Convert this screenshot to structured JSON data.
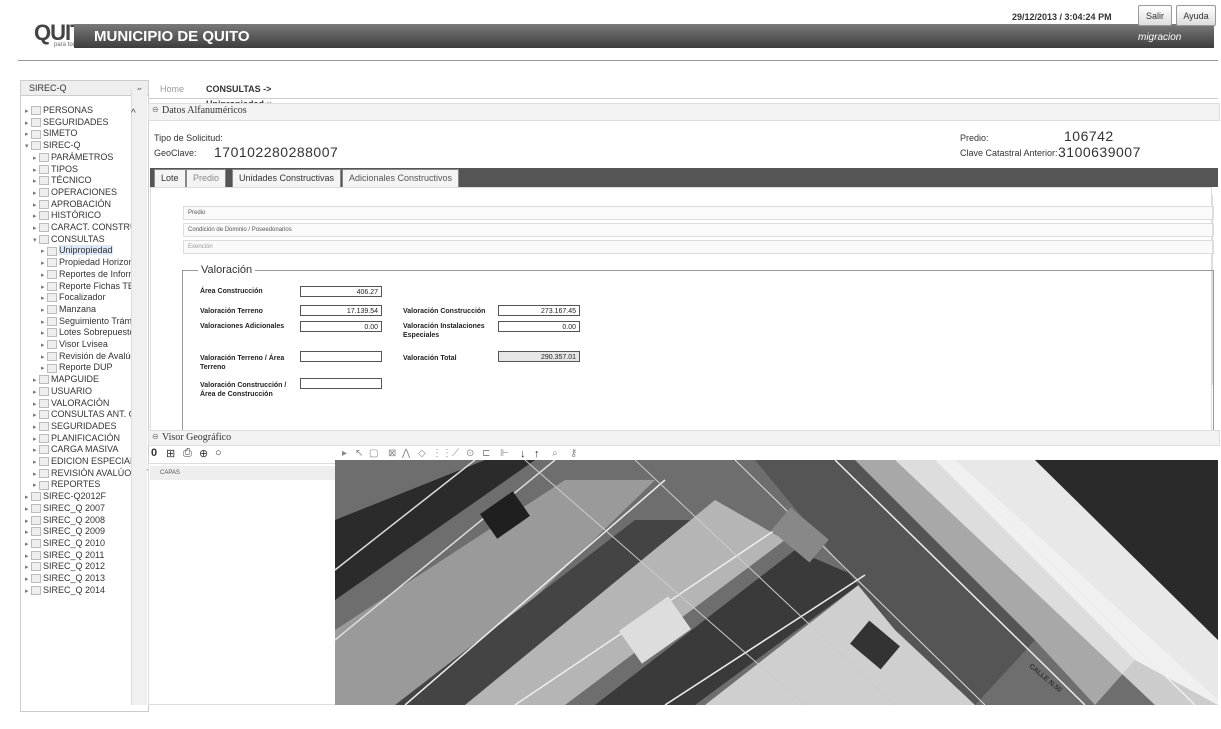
{
  "header": {
    "logo_text": "QUITO",
    "logo_sub": "para todos",
    "brand_title": "MUNICIPIO DE QUITO",
    "datetime": "29/12/2013 / 3:04:24 PM",
    "logout_label": "Salir",
    "help_label": "Ayuda",
    "username": "migracion",
    "brand_color": "#4a4a4a"
  },
  "sidebar": {
    "title": "SIREC-Q",
    "collapse_glyph": "«",
    "items": [
      {
        "label": "PERSONAS",
        "level": 0
      },
      {
        "label": "SEGURIDADES",
        "level": 0
      },
      {
        "label": "SIMETO",
        "level": 0
      },
      {
        "label": "SIREC-Q",
        "level": 0,
        "expanded": true
      },
      {
        "label": "PARÁMETROS",
        "level": 1
      },
      {
        "label": "TIPOS",
        "level": 1
      },
      {
        "label": "TÉCNICO",
        "level": 1
      },
      {
        "label": "OPERACIONES",
        "level": 1
      },
      {
        "label": "APROBACIÓN",
        "level": 1
      },
      {
        "label": "HISTÓRICO",
        "level": 1
      },
      {
        "label": "CARACT. CONSTRUC",
        "level": 1
      },
      {
        "label": "CONSULTAS",
        "level": 1,
        "expanded": true
      },
      {
        "label": "Unipropiedad",
        "level": 2,
        "selected": true
      },
      {
        "label": "Propiedad Horizontal",
        "level": 2
      },
      {
        "label": "Reportes de Informac",
        "level": 2
      },
      {
        "label": "Reporte Fichas TECS",
        "level": 2
      },
      {
        "label": "Focalizador",
        "level": 2
      },
      {
        "label": "Manzana",
        "level": 2
      },
      {
        "label": "Seguimiento Trámites",
        "level": 2
      },
      {
        "label": "Lotes Sobrepuestos",
        "level": 2
      },
      {
        "label": "Visor Lvisea",
        "level": 2
      },
      {
        "label": "Revisión de Avalúo",
        "level": 2
      },
      {
        "label": "Reporte DUP",
        "level": 2
      },
      {
        "label": "MAPGUIDE",
        "level": 1
      },
      {
        "label": "USUARIO",
        "level": 1
      },
      {
        "label": "VALORACIÓN",
        "level": 1
      },
      {
        "label": "CONSULTAS ANT. CAN",
        "level": 1
      },
      {
        "label": "SEGURIDADES",
        "level": 1
      },
      {
        "label": "PLANIFICACIÓN",
        "level": 1
      },
      {
        "label": "CARGA MASIVA",
        "level": 1
      },
      {
        "label": "EDICION ESPECIAL",
        "level": 1
      },
      {
        "label": "REVISIÓN AVALÚO INT",
        "level": 1
      },
      {
        "label": "REPORTES",
        "level": 1
      },
      {
        "label": "SIREC-Q2012F",
        "level": 0
      },
      {
        "label": "SIREC_Q 2007",
        "level": 0
      },
      {
        "label": "SIREC_Q 2008",
        "level": 0
      },
      {
        "label": "SIREC_Q 2009",
        "level": 0
      },
      {
        "label": "SIREC_Q 2010",
        "level": 0
      },
      {
        "label": "SIREC_Q 2011",
        "level": 0
      },
      {
        "label": "SIREC_Q 2012",
        "level": 0
      },
      {
        "label": "SIREC_Q 2013",
        "level": 0
      },
      {
        "label": "SIREC_Q 2014",
        "level": 0
      }
    ]
  },
  "tabs": {
    "home": "Home",
    "active": "CONSULTAS -> Unipropiedad",
    "close_glyph": "×"
  },
  "alfa": {
    "title": "Datos Alfanuméricos",
    "tipo_solicitud_label": "Tipo de Solicitud:",
    "geoclave_label": "GeoClave:",
    "geoclave_value": "170102280288007",
    "predio_label": "Predio:",
    "predio_value": "106742",
    "clave_label": "Clave Catastral Anterior:",
    "clave_value": "3100639007"
  },
  "subtabs": [
    "Lote",
    "Predio",
    "Unidades Constructivas",
    "Adicionales Constructivos"
  ],
  "inner_rows": [
    "Predio",
    "Condición de Dominio / Poseedonarios",
    "Exención"
  ],
  "valoracion": {
    "legend": "Valoración",
    "area_construccion_label": "Área Construcción",
    "area_construccion_value": "406.27",
    "val_terreno_label": "Valoración Terreno",
    "val_terreno_value": "17.139.54",
    "val_adicionales_label": "Valoraciones Adicionales",
    "val_adicionales_value": "0.00",
    "val_terreno_area_label_1": "Valoración Terreno / Área",
    "val_terreno_area_label_2": "Terreno",
    "val_construccion_area_label_1": "Valoración Construcción /",
    "val_construccion_area_label_2": "Área de Construcción",
    "val_construccion_label": "Valoración Construcción",
    "val_construccion_value": "273.167.45",
    "val_instalaciones_label_1": "Valoración Instalaciones",
    "val_instalaciones_label_2": "Especiales",
    "val_instalaciones_value": "0.00",
    "val_total_label": "Valoración Total",
    "val_total_value": "290.357.01"
  },
  "geo": {
    "title": "Visor Geográfico",
    "layers_label": "CAPAS",
    "street_label": "CALLE N.50"
  }
}
